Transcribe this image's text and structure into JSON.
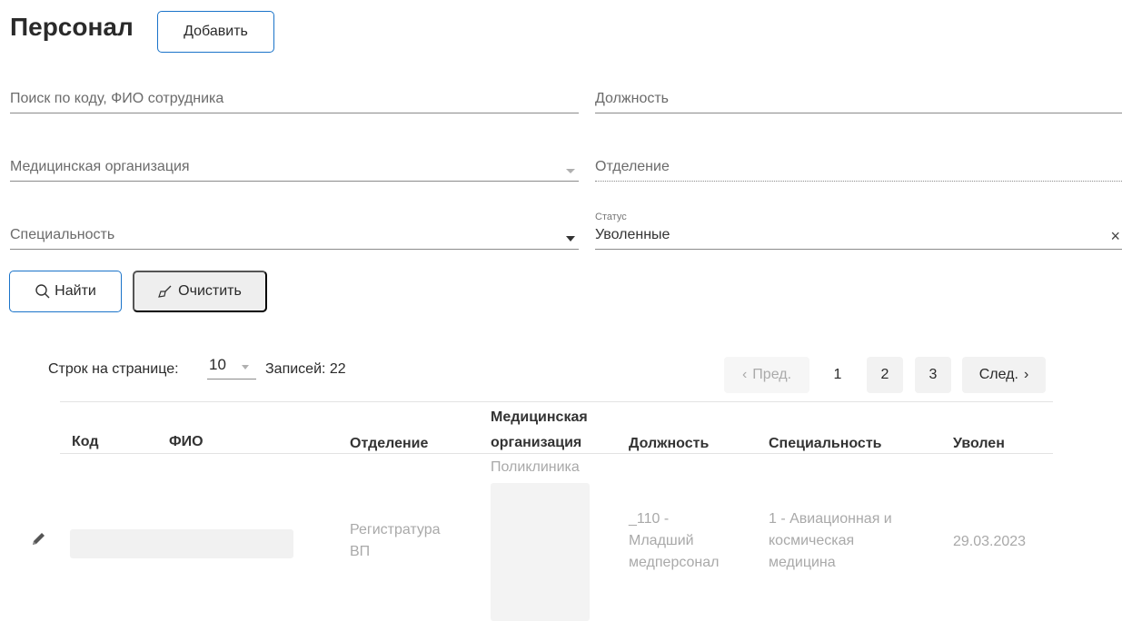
{
  "header": {
    "title": "Персонал",
    "add_label": "Добавить"
  },
  "filters": {
    "search_placeholder": "Поиск по коду, ФИО сотрудника",
    "position_placeholder": "Должность",
    "org_placeholder": "Медицинская организация",
    "department_placeholder": "Отделение",
    "specialty_placeholder": "Специальность",
    "status_label": "Статус",
    "status_value": "Уволенные",
    "clear_symbol": "×"
  },
  "actions": {
    "find_label": "Найти",
    "clear_label": "Очистить"
  },
  "pagination": {
    "rows_label": "Строк на странице:",
    "rows_value": "10",
    "records_label": "Записей:",
    "records_count": "22",
    "prev_label": "Пред.",
    "next_label": "След.",
    "pages": [
      "1",
      "2",
      "3"
    ],
    "current_page": "1"
  },
  "table": {
    "columns": {
      "code": "Код",
      "fio": "ФИО",
      "department": "Отделение",
      "org_line1": "Медицинская",
      "org_line2": "организация",
      "position": "Должность",
      "specialty": "Специальность",
      "dismissed": "Уволен"
    },
    "rows": [
      {
        "org_top": "Поликлиника",
        "department": [
          "Регистратура",
          "ВП"
        ],
        "position": [
          "_110 -",
          "Младший",
          "медперсонал"
        ],
        "specialty": [
          "1 - Авиационная и",
          "космическая",
          "медицина"
        ],
        "dismissed": "29.03.2023"
      }
    ]
  }
}
